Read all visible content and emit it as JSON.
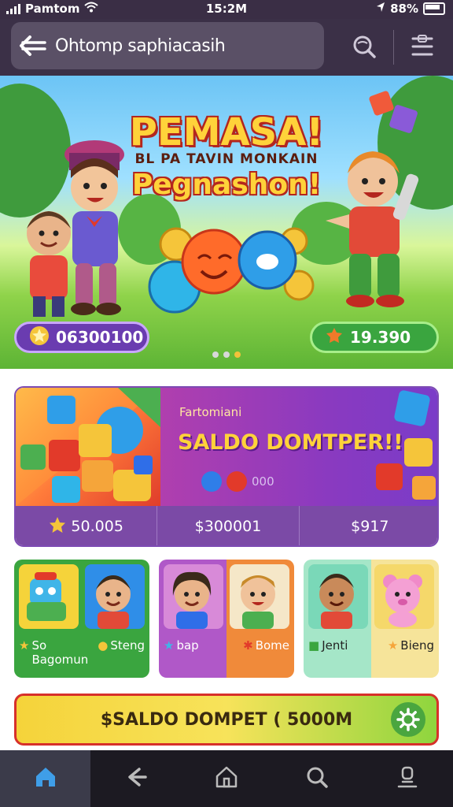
{
  "status_bar": {
    "carrier": "Pamtom",
    "time": "15:2M",
    "battery": "88%"
  },
  "search": {
    "text": "Ohtomp saphiacasih"
  },
  "hero": {
    "title_line1": "PEMASA!",
    "title_line2": "BL PA TAVIN MONKAIN",
    "title_line3": "Pegnashon!",
    "left_pill_value": "06300100",
    "right_pill_value": "19.390"
  },
  "promo": {
    "label": "Fartomiani",
    "headline": "SALDO DOMTPER!!",
    "pager_text": "000",
    "stats": [
      "50.005",
      "$300001",
      "$917"
    ]
  },
  "games": [
    {
      "left_label": "So Bagomun",
      "right_label": "Steng"
    },
    {
      "left_label": "bap",
      "right_label": "Bome"
    },
    {
      "left_label": "Jenti",
      "right_label": "Bieng"
    }
  ],
  "cta": {
    "label": "$SALDO DOMPET ( 5000M"
  },
  "colors": {
    "accent_purple": "#7b4aa6",
    "accent_green": "#3aa53f",
    "accent_yellow": "#ffd23a"
  }
}
